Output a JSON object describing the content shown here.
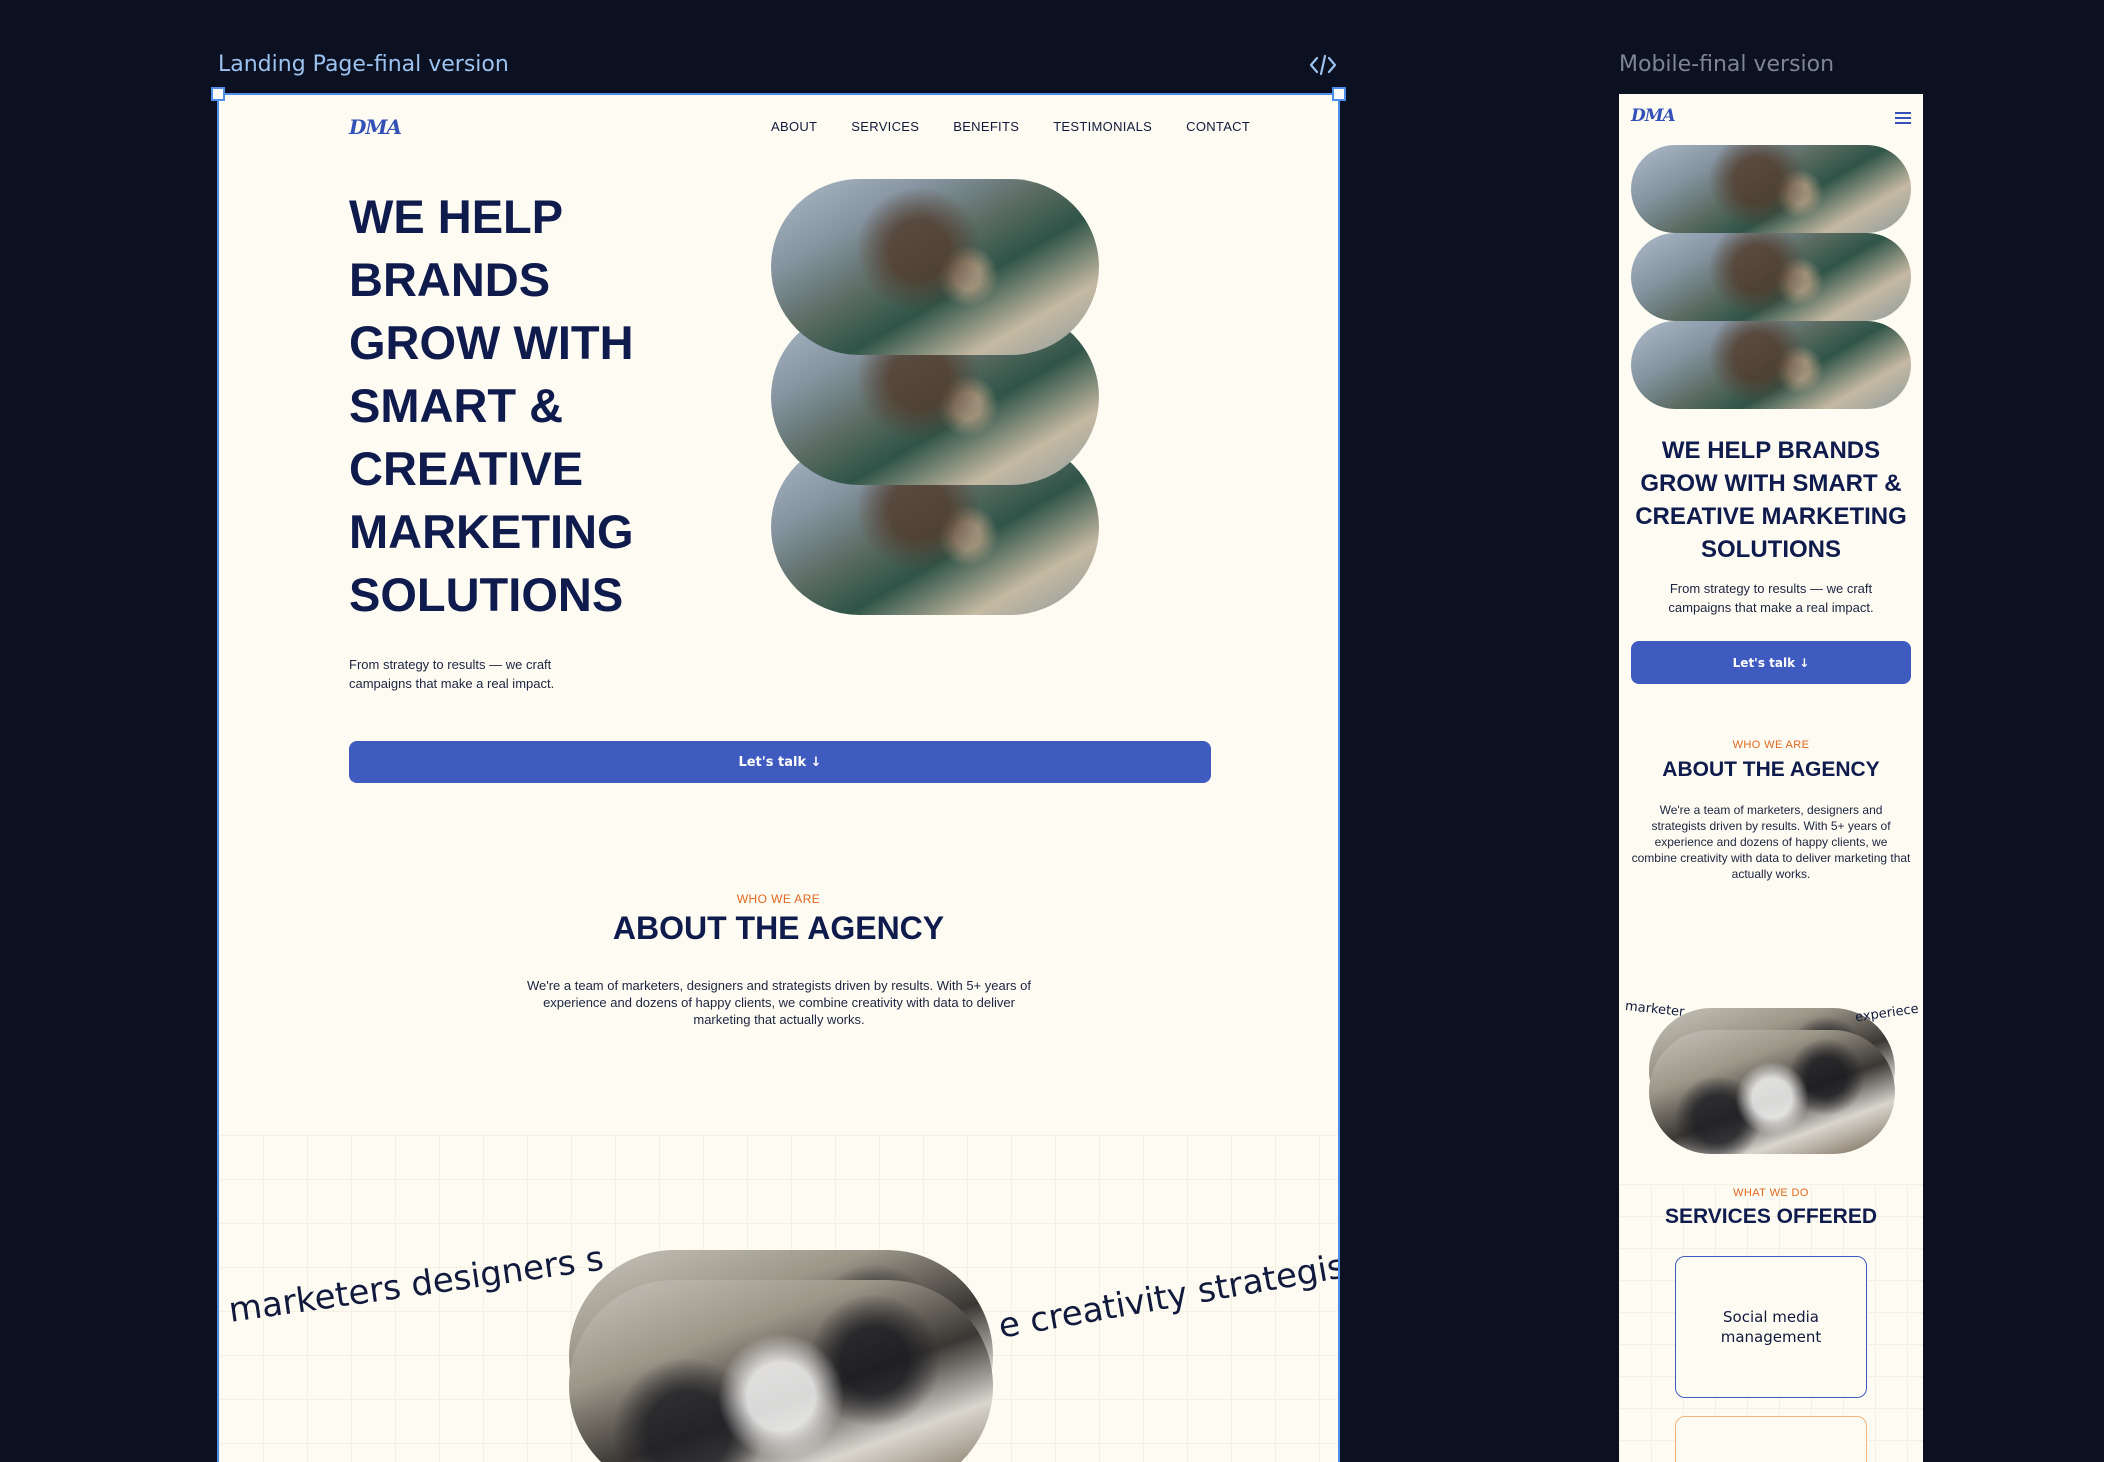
{
  "canvas": {
    "desktop_label": "Landing Page-final version",
    "mobile_label": "Mobile-final version"
  },
  "brand": {
    "logo": "DMA",
    "primary_color": "#3f5bc0",
    "accent_color": "#e2671f",
    "navy": "#0f1b4d"
  },
  "desktop": {
    "nav": [
      "ABOUT",
      "SERVICES",
      "BENEFITS",
      "TESTIMONIALS",
      "CONTACT"
    ],
    "hero_title": "WE HELP BRANDS GROW WITH SMART & CREATIVE MARKETING SOLUTIONS",
    "hero_sub": "From strategy to results — we craft campaigns that make a real impact.",
    "cta": "Let's talk ↓",
    "about": {
      "eyebrow": "WHO WE ARE",
      "title": "ABOUT THE AGENCY",
      "body": "We're a team of marketers, designers and strategists driven by results. With 5+ years of experience and dozens of happy clients, we combine creativity with data to deliver marketing that actually works.",
      "curve_left": "marketers designers s",
      "curve_right": "e creativity strategists"
    }
  },
  "mobile": {
    "logo": "DMA",
    "hero_title": "WE HELP BRANDS GROW WITH SMART & CREATIVE MARKETING SOLUTIONS",
    "hero_sub": "From strategy to results — we craft campaigns that make a real impact.",
    "cta": "Let's talk ↓",
    "about": {
      "eyebrow": "WHO WE ARE",
      "title": "ABOUT THE AGENCY",
      "body": "We're a team of marketers, designers and strategists driven by results. With 5+ years of experience and dozens of happy clients, we combine creativity with data to deliver marketing that actually works.",
      "curve_left": "marketer",
      "curve_right": "experiece"
    },
    "services": {
      "eyebrow": "WHAT WE DO",
      "title": "SERVICES OFFERED",
      "cards": [
        "Social media management"
      ]
    }
  },
  "icons": {
    "code": "code-brackets-icon",
    "menu": "hamburger-menu-icon"
  }
}
